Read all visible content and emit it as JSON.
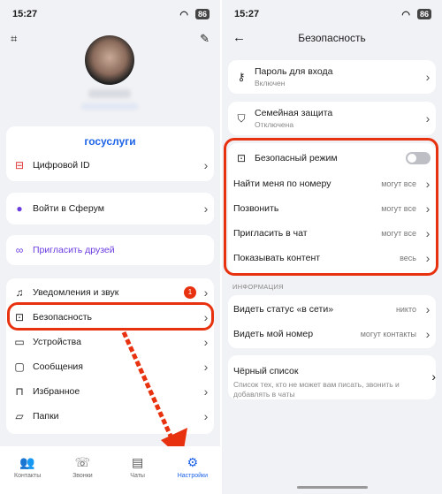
{
  "status": {
    "time": "15:27",
    "battery": "86"
  },
  "left": {
    "gosuslugi_logo": "госуслуги",
    "items": {
      "digital_id": "Цифровой ID",
      "sferum": "Войти в Сферум",
      "invite": "Пригласить друзей",
      "notifications": "Уведомления и звук",
      "notifications_badge": "1",
      "security": "Безопасность",
      "devices": "Устройства",
      "messages": "Сообщения",
      "favorites": "Избранное",
      "folders": "Папки"
    },
    "nav": {
      "contacts": "Контакты",
      "calls": "Звонки",
      "chats": "Чаты",
      "settings": "Настройки"
    }
  },
  "right": {
    "title": "Безопасность",
    "password": {
      "label": "Пароль для входа",
      "sub": "Включен"
    },
    "family": {
      "label": "Семейная защита",
      "sub": "Отключена"
    },
    "safe_mode": "Безопасный режим",
    "privacy": [
      {
        "label": "Найти меня по номеру",
        "value": "могут все"
      },
      {
        "label": "Позвонить",
        "value": "могут все"
      },
      {
        "label": "Пригласить в чат",
        "value": "могут все"
      },
      {
        "label": "Показывать контент",
        "value": "весь"
      }
    ],
    "section_info": "ИНФОРМАЦИЯ",
    "info": [
      {
        "label": "Видеть статус «в сети»",
        "value": "никто"
      },
      {
        "label": "Видеть мой номер",
        "value": "могут контакты"
      }
    ],
    "blacklist": {
      "label": "Чёрный список",
      "sub": "Список тех, кто не может вам писать, звонить и добавлять в чаты"
    }
  },
  "colors": {
    "accent": "#1c63e7",
    "highlight": "#e8320f",
    "invite": "#6b3ce0"
  }
}
